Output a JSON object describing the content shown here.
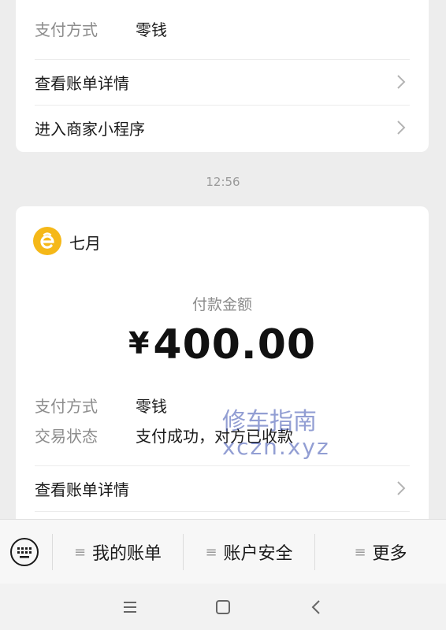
{
  "top_card": {
    "payment_method_label": "支付方式",
    "payment_method_value": "零钱",
    "view_bill_label": "查看账单详情",
    "mini_program_label": "进入商家小程序"
  },
  "timestamp": "12:56",
  "main_card": {
    "merchant_name": "七月",
    "merchant_logo_color": "#f5b818",
    "amount_label": "付款金额",
    "currency": "¥",
    "amount": "400.00",
    "payment_method_label": "支付方式",
    "payment_method_value": "零钱",
    "status_label": "交易状态",
    "status_value": "支付成功，对方已收款",
    "view_bill_label": "查看账单详情"
  },
  "watermark": {
    "line1": "修车指南",
    "line2": "xczn.xyz"
  },
  "bottom_menu": {
    "keyboard_icon": "keyboard-icon",
    "items": [
      {
        "label": "我的账单",
        "icon": "menu-lines-icon"
      },
      {
        "label": "账户安全",
        "icon": "menu-lines-icon"
      },
      {
        "label": "更多",
        "icon": "menu-lines-icon"
      }
    ]
  },
  "system_nav": {
    "menu": "menu-icon",
    "home": "home-icon",
    "back": "back-icon"
  }
}
